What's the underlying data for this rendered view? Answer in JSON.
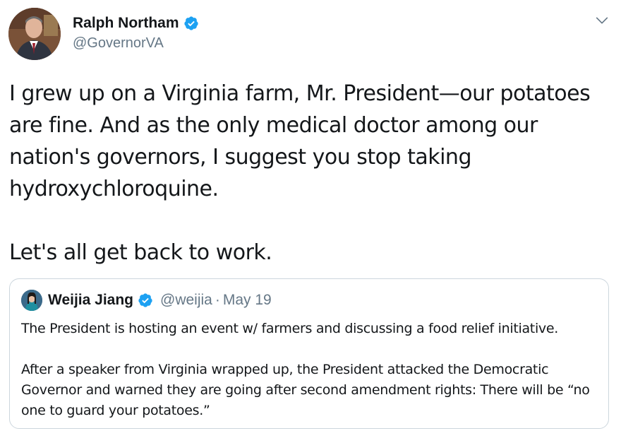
{
  "author": {
    "name": "Ralph Northam",
    "handle": "@GovernorVA",
    "verified": true
  },
  "tweet": {
    "text": "I grew up on a Virginia farm, Mr. President—our potatoes are fine. And as the only medical doctor among our nation's governors, I suggest you stop taking hydroxychloroquine.\n\nLet's all get back to work."
  },
  "quoted": {
    "name": "Weijia Jiang",
    "handle": "@weijia",
    "separator": "·",
    "date": "May 19",
    "verified": true,
    "paragraph1": "The President is hosting an event w/ farmers and discussing a food relief initiative.",
    "paragraph2": "After a speaker from Virginia wrapped up, the President attacked the Democratic Governor and warned they are going after second amendment rights: There will be “no one to guard your potatoes.”"
  },
  "colors": {
    "text": "#14171a",
    "secondary": "#657786",
    "verified": "#1da1f2",
    "border": "#ccd6dd"
  },
  "icons": {
    "verified": "verified-badge-icon",
    "menu": "chevron-down-icon"
  }
}
